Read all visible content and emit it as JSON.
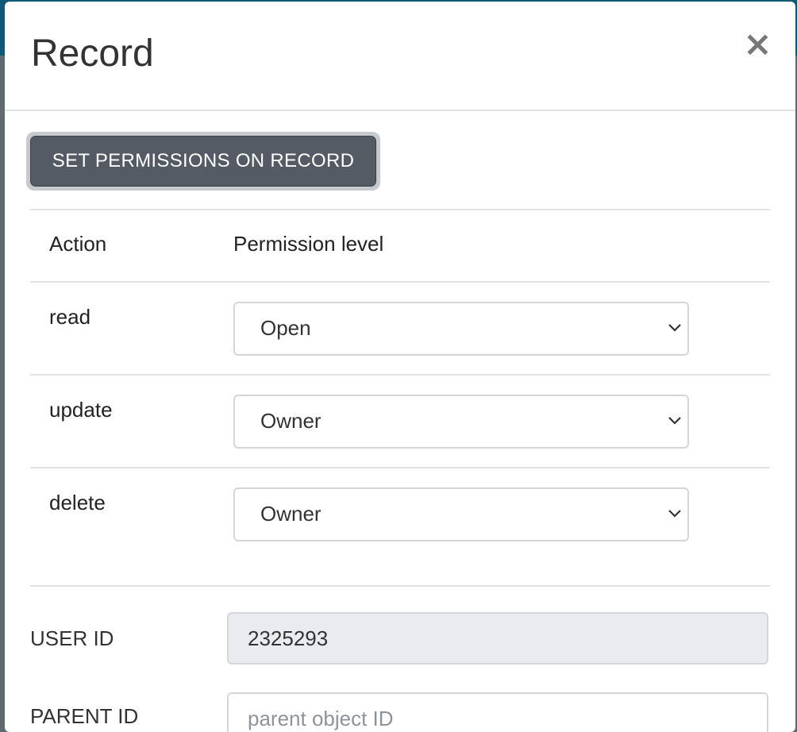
{
  "modal": {
    "title": "Record",
    "close_label": "×"
  },
  "permissions": {
    "button_label": "SET PERMISSIONS ON RECORD",
    "headers": {
      "action": "Action",
      "level": "Permission level"
    },
    "rows": [
      {
        "action": "read",
        "level": "Open"
      },
      {
        "action": "update",
        "level": "Owner"
      },
      {
        "action": "delete",
        "level": "Owner"
      }
    ]
  },
  "fields": {
    "user_id": {
      "label": "USER ID",
      "value": "2325293"
    },
    "parent_id": {
      "label": "PARENT ID",
      "placeholder": "parent object ID"
    }
  },
  "colors": {
    "button_bg": "#545b64",
    "backdrop_header": "#0e5a74"
  },
  "icons": {
    "close": "close-icon",
    "select_arrow": "chevron-down-icon"
  }
}
